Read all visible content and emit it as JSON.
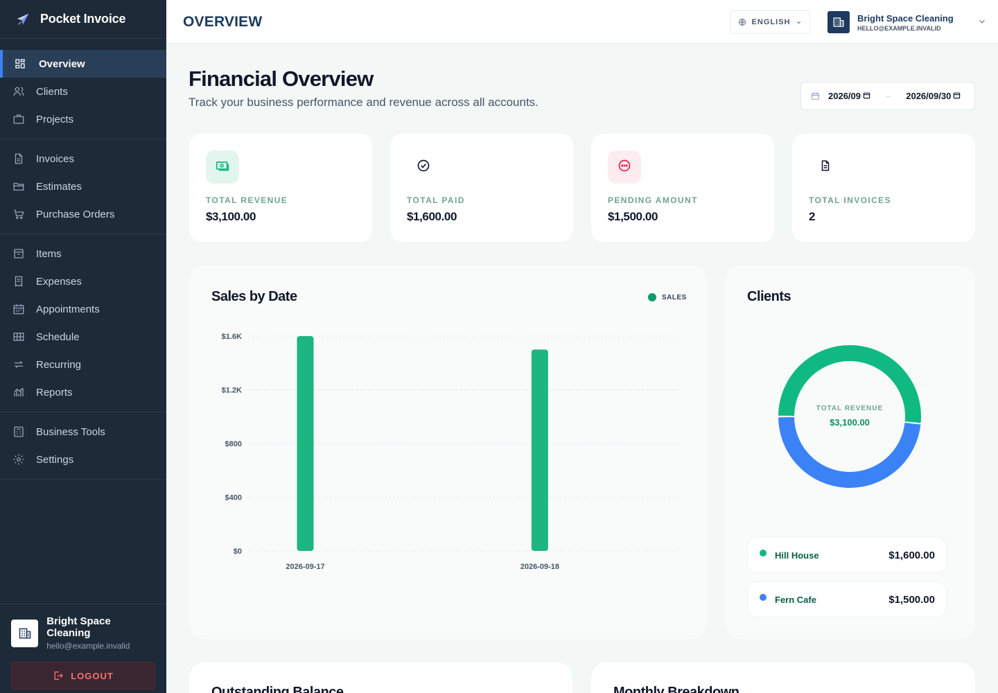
{
  "app": {
    "name": "Pocket Invoice"
  },
  "sidebar": {
    "groups": [
      [
        {
          "label": "Overview",
          "icon": "grid-icon",
          "active": true
        },
        {
          "label": "Clients",
          "icon": "users-icon"
        },
        {
          "label": "Projects",
          "icon": "briefcase-icon"
        }
      ],
      [
        {
          "label": "Invoices",
          "icon": "document-icon"
        },
        {
          "label": "Estimates",
          "icon": "folder-icon"
        },
        {
          "label": "Purchase Orders",
          "icon": "cart-icon"
        }
      ],
      [
        {
          "label": "Items",
          "icon": "archive-icon"
        },
        {
          "label": "Expenses",
          "icon": "receipt-icon"
        },
        {
          "label": "Appointments",
          "icon": "calendar-icon"
        },
        {
          "label": "Schedule",
          "icon": "table-icon"
        },
        {
          "label": "Recurring",
          "icon": "repeat-icon"
        },
        {
          "label": "Reports",
          "icon": "chart-icon"
        }
      ],
      [
        {
          "label": "Business Tools",
          "icon": "calculator-icon"
        },
        {
          "label": "Settings",
          "icon": "gear-icon"
        }
      ]
    ],
    "footer": {
      "business_name": "Bright Space Cleaning",
      "email": "hello@example.invalid",
      "logout_label": "LOGOUT"
    }
  },
  "header": {
    "page_title": "OVERVIEW",
    "language": "ENGLISH",
    "account_name": "Bright Space Cleaning",
    "account_email": "HELLO@EXAMPLE.INVALID"
  },
  "main": {
    "title": "Financial Overview",
    "subtitle": "Track your business performance and revenue across all accounts.",
    "date_from": "2026/09",
    "date_to": "2026/09/30",
    "date_separator": "–"
  },
  "stats": [
    {
      "label": "TOTAL REVENUE",
      "value": "$3,100.00",
      "icon": "cash-icon",
      "badge_bg": "#e3f6ee",
      "icon_color": "#10b981"
    },
    {
      "label": "TOTAL PAID",
      "value": "$1,600.00",
      "icon": "check-circle-icon",
      "badge_bg": "#ffffff",
      "icon_color": "#0f172a"
    },
    {
      "label": "PENDING AMOUNT",
      "value": "$1,500.00",
      "icon": "pending-circle-icon",
      "badge_bg": "#fdecef",
      "icon_color": "#e11d48"
    },
    {
      "label": "TOTAL INVOICES",
      "value": "2",
      "icon": "document-icon",
      "badge_bg": "#ffffff",
      "icon_color": "#0f172a"
    }
  ],
  "sales_card": {
    "title": "Sales by Date",
    "legend": "SALES"
  },
  "chart_data": {
    "type": "bar",
    "categories": [
      "2026-09-17",
      "2026-09-18"
    ],
    "series": [
      {
        "name": "SALES",
        "values": [
          1600,
          1500
        ]
      }
    ],
    "ylim": [
      0,
      1600
    ],
    "yticks": [
      "$0",
      "$400",
      "$800",
      "$1.2K",
      "$1.6K"
    ],
    "ytick_values": [
      0,
      400,
      800,
      1200,
      1600
    ],
    "grid": true,
    "legend_position": "top-right",
    "bar_color": "#1db580"
  },
  "clients_card": {
    "title": "Clients",
    "center_label": "TOTAL REVENUE",
    "center_value": "$3,100.00",
    "clients": [
      {
        "name": "Hill House",
        "amount": "$1,600.00",
        "value": 1600,
        "color": "#10b981"
      },
      {
        "name": "Fern Cafe",
        "amount": "$1,500.00",
        "value": 1500,
        "color": "#3b82f6"
      }
    ]
  },
  "bottom_cards": [
    "Outstanding Balance",
    "Monthly Breakdown"
  ]
}
